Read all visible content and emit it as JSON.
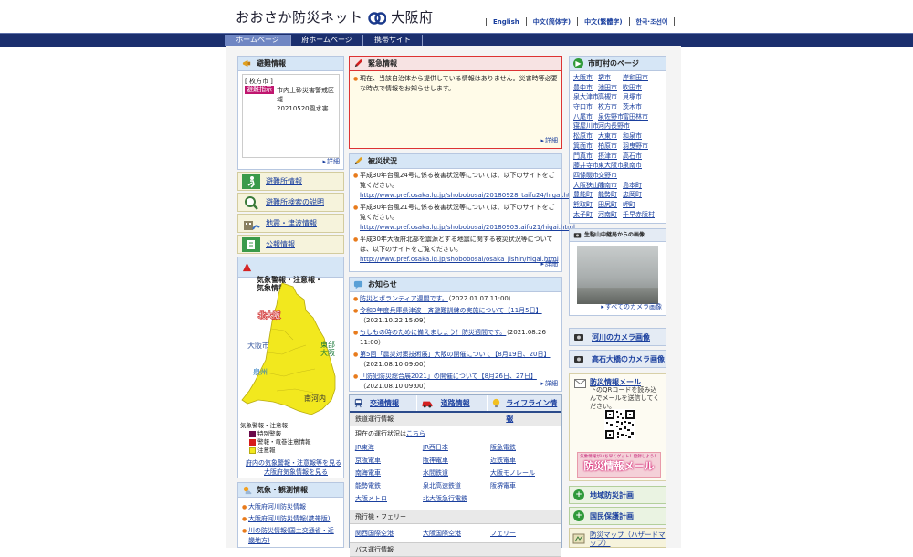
{
  "header": {
    "site_name": "おおさか防災ネット",
    "org_name": "大阪府",
    "languages": [
      "English",
      "中文(简体字)",
      "中文(繁體字)",
      "한국·조선어"
    ]
  },
  "nav": {
    "tabs": [
      "ホームページ",
      "府ホームページ",
      "携帯サイト"
    ]
  },
  "evacuation": {
    "title": "避難情報",
    "area": "[ 枚方市 ]",
    "badge": "避難指示",
    "text": "市内土砂災害警戒区域\n20210520風水害",
    "more": "詳細"
  },
  "side_buttons": [
    "避難所情報",
    "避難所検索の説明",
    "地震・津波情報",
    "公報情報"
  ],
  "warnings": {
    "title": "気象警報・注意報・\n気象情報",
    "map_labels": [
      "北大阪",
      "東部大阪",
      "大阪市",
      "泉州",
      "南河内"
    ],
    "legend_title": "気象警報・注意報",
    "legend": [
      "特別警報",
      "警報・竜巻注意情報",
      "注意報"
    ],
    "link1": "府内の気象警報・注意報等を見る",
    "link2": "大阪府気象情報を見る"
  },
  "weather_obs": {
    "title": "気象・観測情報",
    "links": [
      "大阪府河川防災情報",
      "大阪府河川防災情報(携帯版)",
      "川の防災情報(国土交通省・近畿地方)"
    ]
  },
  "emergency": {
    "title": "緊急情報",
    "text": "現在、当該自治体から提供している情報はありません。災害時等必要な時点で情報をお知らせします。",
    "more": "詳細"
  },
  "damage": {
    "title": "被災状況",
    "items": [
      {
        "text": "平成30年台風24号に係る被害状況等については、以下のサイトをご覧ください。",
        "url": "http://www.pref.osaka.lg.jp/shobobosai/20180928_taifu24/higai.html"
      },
      {
        "text": "平成30年台風21号に係る被害状況等については、以下のサイトをご覧ください。",
        "url": "http://www.pref.osaka.lg.jp/shobobosai/20180903taifu21/higai.html"
      },
      {
        "text": "平成30年大阪府北部を震源とする地震に関する被災状況等については、以下のサイトをご覧ください。",
        "url": "http://www.pref.osaka.lg.jp/shobobosai/osaka_jishin/higai.html"
      }
    ],
    "more": "詳細"
  },
  "notices": {
    "title": "お知らせ",
    "items": [
      {
        "link": "防災とボランティア週間です。",
        "date": "（2022.01.07 11:00）"
      },
      {
        "link": "令和3年度兵庫県津波一斉避難訓練の実施について【11月5日】",
        "date": "（2021.10.22 15:09）"
      },
      {
        "link": "もしもの時のために備えましょう！防災週間です。",
        "date": "（2021.08.26 11:00）"
      },
      {
        "link": "第5回「震災対策技術展」大阪の開催について【8月19日、20日】",
        "date": "（2021.08.10 09:00）"
      },
      {
        "link": "「防犯防災総合展2021」の開催について【8月26日、27日】",
        "date": "（2021.08.10 09:00）"
      }
    ],
    "more": "詳細"
  },
  "transport": {
    "tabs": [
      "交通情報",
      "道路情報",
      "ライフライン情報"
    ],
    "rail_title": "鉄道運行情報",
    "rail_status_prefix": "現在の運行状況は",
    "rail_status_link": "こちら",
    "rail": [
      "JR東海",
      "JR西日本",
      "阪急電鉄",
      "京阪電車",
      "阪神電車",
      "近鉄電車",
      "南海電車",
      "水間鉄道",
      "大阪モノレール",
      "能勢電鉄",
      "泉北高速鉄道",
      "阪堺電車",
      "大阪メトロ",
      "北大阪急行電鉄"
    ],
    "air_title": "飛行機・フェリー",
    "air": [
      "関西国際空港",
      "大阪国際空港",
      "フェリー"
    ],
    "bus_title": "バス運行情報"
  },
  "municipal": {
    "title": "市町村のページ",
    "towns": [
      "大阪市",
      "堺市",
      "岸和田市",
      "豊中市",
      "池田市",
      "吹田市",
      "泉大津市",
      "高槻市",
      "貝塚市",
      "守口市",
      "枚方市",
      "茨木市",
      "八尾市",
      "泉佐野市",
      "富田林市",
      "寝屋川市",
      "河内長野市",
      "",
      "松原市",
      "大東市",
      "和泉市",
      "箕面市",
      "柏原市",
      "羽曳野市",
      "門真市",
      "摂津市",
      "高石市",
      "藤井寺市",
      "東大阪市",
      "泉南市",
      "四條畷市",
      "交野市",
      "",
      "大阪狭山市",
      "阪南市",
      "島本町",
      "豊能町",
      "能勢町",
      "忠岡町",
      "熊取町",
      "田尻町",
      "岬町",
      "太子町",
      "河南町",
      "千早赤阪村"
    ]
  },
  "camera": {
    "title": "生駒山中継局からの画像",
    "link": "すべてのカメラ画像",
    "river": "河川のカメラ画像",
    "bridge": "高石大橋のカメラ画像"
  },
  "mail": {
    "title": "防災情報メール",
    "text": "下のQRコードを読み込んでメールを送信してください。",
    "banner_small": "気象情報がいち早くゲット！登録しよう！",
    "banner_big": "防災情報メール"
  },
  "right_buttons": [
    "地域防災計画",
    "国民保護計画"
  ],
  "hazard": "防災マップ（ハザードマップ）"
}
